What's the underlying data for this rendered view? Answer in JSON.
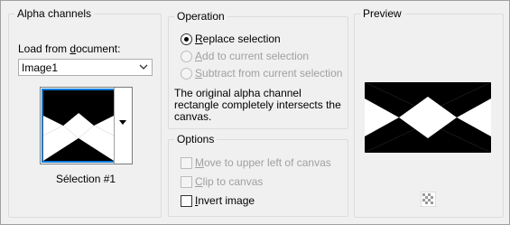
{
  "alpha_channels": {
    "group_title": "Alpha channels",
    "load_label": "Load from document:",
    "document_select": "Image1",
    "selection_name": "Sélection #1"
  },
  "operation": {
    "group_title": "Operation",
    "options": [
      {
        "label": "Replace selection",
        "selected": true,
        "enabled": true
      },
      {
        "label": "Add to current selection",
        "selected": false,
        "enabled": false
      },
      {
        "label": "Subtract from current selection",
        "selected": false,
        "enabled": false
      }
    ],
    "message": "The original alpha channel rectangle completely intersects the canvas.",
    "message_line1": "The original alpha channel",
    "message_line2": "rectangle completely intersects the",
    "message_line3": "canvas."
  },
  "options": {
    "group_title": "Options",
    "move_label": "Move to upper left of canvas",
    "clip_label": "Clip to canvas",
    "invert_label": "Invert image"
  },
  "preview": {
    "group_title": "Preview"
  },
  "colors": {
    "accent": "#0078d7",
    "disabled_text": "#a0a0a0"
  }
}
